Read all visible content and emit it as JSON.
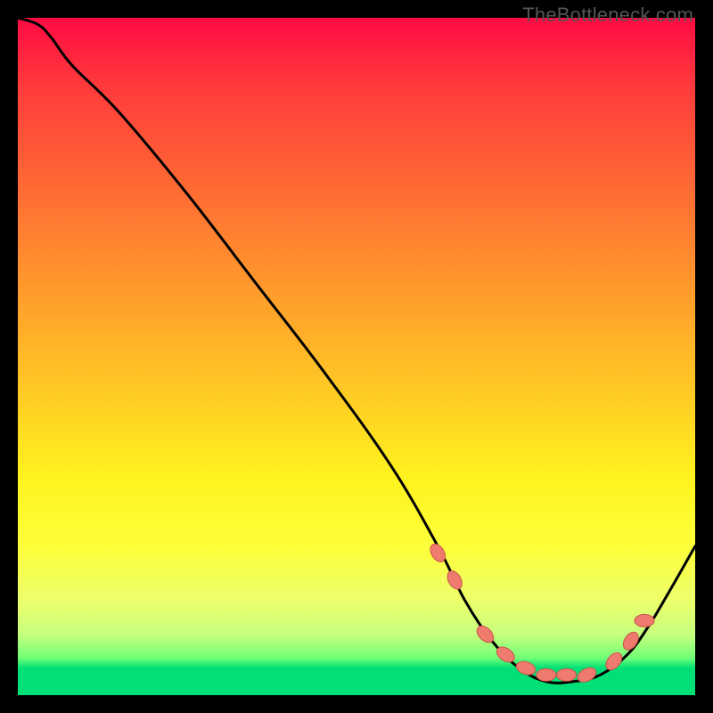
{
  "watermark": "TheBottleneck.com",
  "chart_data": {
    "type": "line",
    "title": "",
    "xlabel": "",
    "ylabel": "",
    "xlim": [
      0,
      100
    ],
    "ylim": [
      0,
      100
    ],
    "grid": false,
    "legend": false,
    "series": [
      {
        "name": "curve",
        "x": [
          0,
          3,
          5,
          8,
          15,
          25,
          35,
          45,
          55,
          62,
          66,
          70,
          74,
          78,
          82,
          86,
          90,
          93,
          96,
          100
        ],
        "values": [
          100,
          99,
          97,
          93,
          86,
          74,
          61,
          48,
          34,
          22,
          14,
          8,
          4,
          2,
          2,
          3,
          6,
          10,
          15,
          22
        ]
      }
    ],
    "markers": {
      "name": "highlight-dots",
      "x": [
        62,
        64.5,
        69,
        72,
        75,
        78,
        81,
        84,
        88,
        90.5,
        92.5
      ],
      "values": [
        21,
        17,
        9,
        6,
        4,
        3,
        3,
        3,
        5,
        8,
        11
      ],
      "rshort": 7,
      "rlong": 11
    },
    "colors": {
      "curve": "#000000",
      "marker_fill": "#ef7b6e",
      "marker_stroke": "#c85548"
    }
  }
}
